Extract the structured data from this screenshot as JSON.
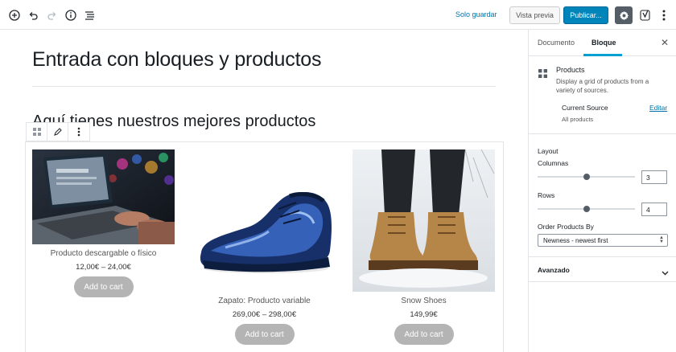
{
  "toolbar": {
    "icons": [
      "add-block-icon",
      "undo-icon",
      "redo-icon",
      "info-icon",
      "list-view-icon"
    ],
    "save_draft": "Solo guardar",
    "preview": "Vista previa",
    "publish": "Publicar...",
    "settings_icon": "gear-icon",
    "yoast_icon": "yoast-icon",
    "more_icon": "more-vertical-icon",
    "colors": {
      "publish_bg": "#0085ba",
      "settings_bg": "#555d66",
      "link": "#0073aa"
    }
  },
  "editor": {
    "title": "Entrada con bloques y productos",
    "heading": "Aquí tienes nuestros mejores productos",
    "block_toolbar": [
      "block-type-grid-icon",
      "pencil-icon",
      "more-options-icon"
    ],
    "products": [
      {
        "name": "Producto descargable o físico",
        "price": "12,00€ – 24,00€",
        "button": "Add to cart",
        "image": "laptop-photo"
      },
      {
        "name": "Zapato: Producto variable",
        "price": "269,00€ – 298,00€",
        "button": "Add to cart",
        "image": "blue-shoe-photo"
      },
      {
        "name": "Snow Shoes",
        "price": "149,99€",
        "button": "Add to cart",
        "image": "snow-boots-photo"
      }
    ]
  },
  "sidebar": {
    "tabs": [
      {
        "label": "Documento",
        "active": false
      },
      {
        "label": "Bloque",
        "active": true
      }
    ],
    "close_icon": "close-icon",
    "block": {
      "title": "Products",
      "description": "Display a grid of products from a variety of sources.",
      "current_source_label": "Current Source",
      "edit_link": "Editar",
      "current_source_value": "All products"
    },
    "layout": {
      "heading": "Layout",
      "columns_label": "Columnas",
      "columns_value": "3",
      "columns_fraction": 0.5,
      "rows_label": "Rows",
      "rows_value": "4",
      "rows_fraction": 0.5,
      "order_label": "Order Products By",
      "order_value": "Newness - newest first"
    },
    "advanced": {
      "label": "Avanzado"
    }
  }
}
